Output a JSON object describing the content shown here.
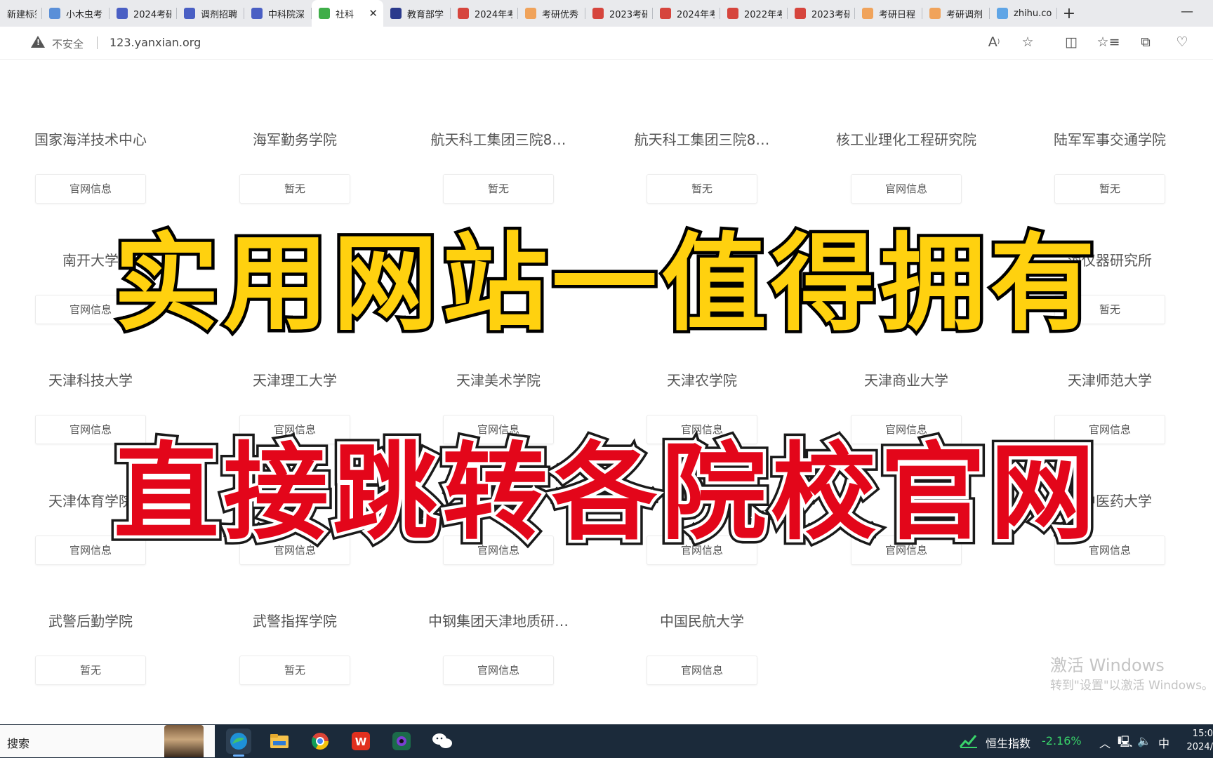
{
  "tabs": [
    {
      "label": "新建标签",
      "favicon": "blank-page-icon",
      "color": "#9aa0a6"
    },
    {
      "label": "小木虫考",
      "favicon": "search-icon",
      "color": "#5a8fd8"
    },
    {
      "label": "2024考研",
      "favicon": "grid-icon",
      "color": "#4a5fc4"
    },
    {
      "label": "调剂招聘",
      "favicon": "grid-icon",
      "color": "#4a5fc4"
    },
    {
      "label": "中科院深",
      "favicon": "grid-icon",
      "color": "#4a5fc4"
    },
    {
      "label": "社科",
      "favicon": "leaf-icon",
      "color": "#3fae49",
      "active": true
    },
    {
      "label": "教育部学",
      "favicon": "graduation-cap-icon",
      "color": "#2b3a8c"
    },
    {
      "label": "2024年考",
      "favicon": "red-logo-icon",
      "color": "#d6453d"
    },
    {
      "label": "考研优秀",
      "favicon": "orange-face-icon",
      "color": "#f0a35b"
    },
    {
      "label": "2023考研",
      "favicon": "red-logo-icon",
      "color": "#d6453d"
    },
    {
      "label": "2024年考",
      "favicon": "red-logo-icon",
      "color": "#d6453d"
    },
    {
      "label": "2022年考",
      "favicon": "red-logo-icon",
      "color": "#d6453d"
    },
    {
      "label": "2023考研",
      "favicon": "red-logo-icon",
      "color": "#d6453d"
    },
    {
      "label": "考研日程",
      "favicon": "orange-face-icon",
      "color": "#f0a35b"
    },
    {
      "label": "考研调剂",
      "favicon": "orange-face-icon",
      "color": "#f0a35b"
    },
    {
      "label": "zhihu.co",
      "favicon": "zhihu-icon",
      "color": "#5fa5e6"
    }
  ],
  "address": {
    "security_label": "不安全",
    "url": "123.yanxian.org"
  },
  "toolbar_icons": [
    "read-aloud-icon",
    "favorite-star-icon",
    "split-screen-icon",
    "favorites-list-icon",
    "collections-icon",
    "browser-essentials-icon"
  ],
  "schools": [
    [
      {
        "name": "国家海洋技术中心",
        "button": "官网信息"
      },
      {
        "name": "海军勤务学院",
        "button": "暂无"
      },
      {
        "name": "航天科工集团三院8…",
        "button": "暂无"
      },
      {
        "name": "航天科工集团三院8…",
        "button": "暂无"
      },
      {
        "name": "核工业理化工程研究院",
        "button": "官网信息"
      },
      {
        "name": "陆军军事交通学院",
        "button": "暂无"
      }
    ],
    [
      {
        "name": "南开大学",
        "button": "官网信息"
      },
      {
        "name": "",
        "button": ""
      },
      {
        "name": "",
        "button": ""
      },
      {
        "name": "",
        "button": ""
      },
      {
        "name": "",
        "button": ""
      },
      {
        "name": "海仪器研究所",
        "button": "暂无"
      }
    ],
    [
      {
        "name": "天津科技大学",
        "button": "官网信息"
      },
      {
        "name": "天津理工大学",
        "button": "官网信息"
      },
      {
        "name": "天津美术学院",
        "button": "官网信息"
      },
      {
        "name": "天津农学院",
        "button": "官网信息"
      },
      {
        "name": "天津商业大学",
        "button": "官网信息"
      },
      {
        "name": "天津师范大学",
        "button": "官网信息"
      }
    ],
    [
      {
        "name": "天津体育学院",
        "button": "官网信息"
      },
      {
        "name": "",
        "button": "官网信息"
      },
      {
        "name": "",
        "button": "官网信息"
      },
      {
        "name": "",
        "button": "官网信息"
      },
      {
        "name": "",
        "button": "官网信息"
      },
      {
        "name": "津中医药大学",
        "button": "官网信息"
      }
    ],
    [
      {
        "name": "武警后勤学院",
        "button": "暂无"
      },
      {
        "name": "武警指挥学院",
        "button": "暂无"
      },
      {
        "name": "中钢集团天津地质研…",
        "button": "官网信息"
      },
      {
        "name": "中国民航大学",
        "button": "官网信息"
      }
    ]
  ],
  "overlay": {
    "headline": "实用网站一值得拥有",
    "subheadline": "直接跳转各院校官网",
    "headline_color": "#ffd10f",
    "subheadline_color": "#e3061a"
  },
  "watermark": {
    "line1": "激活 Windows",
    "line2": "转到\"设置\"以激活 Windows。"
  },
  "taskbar": {
    "search_label": "搜索",
    "apps": [
      "edge-icon",
      "file-explorer-icon",
      "chrome-icon",
      "wps-icon",
      "screen-recorder-icon",
      "wechat-icon"
    ],
    "stock_name": "恒生指数",
    "stock_change": "-2.16%",
    "ime": "中",
    "time": "15:0",
    "date": "2024/"
  }
}
